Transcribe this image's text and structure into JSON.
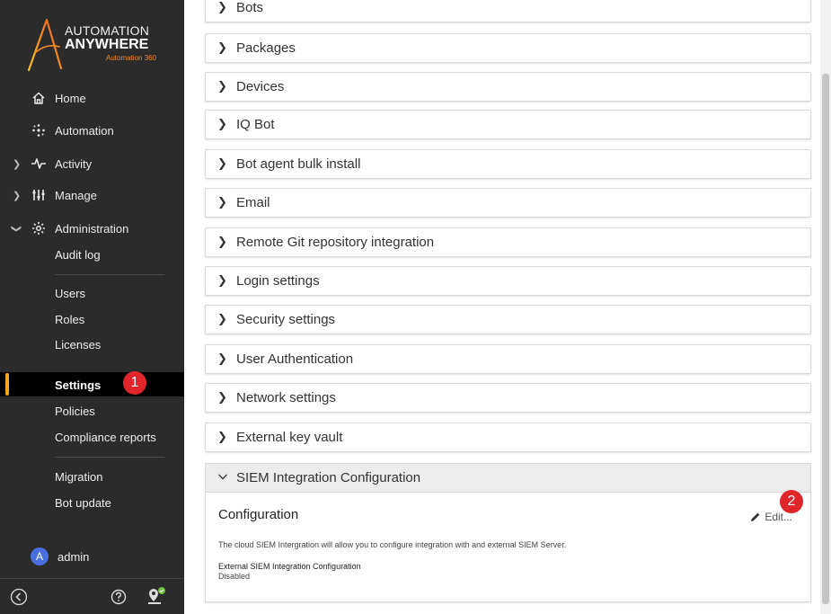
{
  "brand": {
    "line1": "AUTOMATION",
    "line2": "ANYWHERE",
    "tagline": "Automation 360",
    "accent_color": "#f08a24"
  },
  "nav": {
    "home": "Home",
    "automation": "Automation",
    "activity": "Activity",
    "manage": "Manage",
    "administration": "Administration"
  },
  "admin_submenu": {
    "audit_log": "Audit log",
    "users": "Users",
    "roles": "Roles",
    "licenses": "Licenses",
    "settings": "Settings",
    "policies": "Policies",
    "compliance_reports": "Compliance reports",
    "migration": "Migration",
    "bot_update": "Bot update"
  },
  "user": {
    "avatar_initial": "A",
    "name": "admin"
  },
  "annotations": {
    "step1": "1",
    "step2": "2"
  },
  "sections": [
    "Bots",
    "Packages",
    "Devices",
    "IQ Bot",
    "Bot agent bulk install",
    "Email",
    "Remote Git repository integration",
    "Login settings",
    "Security settings",
    "User Authentication",
    "Network settings",
    "External key vault"
  ],
  "siem": {
    "header": "SIEM Integration Configuration",
    "config_title": "Configuration",
    "edit_label": "Edit...",
    "description": "The cloud SIEM Intergration will allow you to configure integration with and external SIEM Server.",
    "field_label": "External SIEM Integration Configuration",
    "field_value": "Disabled"
  },
  "colors": {
    "sidebar_bg": "#2b2b2b",
    "active_bg": "#000000",
    "active_accent": "#f5a623",
    "badge_red": "#e0262b",
    "avatar_blue": "#4a6ee0"
  }
}
